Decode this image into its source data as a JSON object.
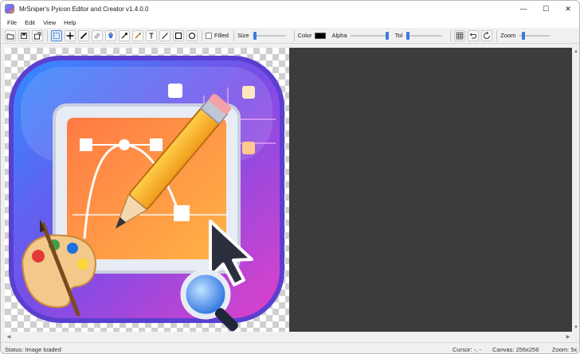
{
  "window": {
    "title": "MrSniper's Pyicon Editor and Creator v1.4.0.0",
    "controls": {
      "minimize": "—",
      "maximize": "☐",
      "close": "✕"
    }
  },
  "menu": {
    "items": [
      "File",
      "Edit",
      "View",
      "Help"
    ]
  },
  "toolbar": {
    "file_tools": [
      "open-icon",
      "save-icon",
      "export-icon"
    ],
    "draw_tools": [
      {
        "icon": "select-icon",
        "active": true
      },
      {
        "icon": "move-icon",
        "active": false
      },
      {
        "icon": "pencil-icon",
        "active": false
      },
      {
        "icon": "eraser-icon",
        "active": false
      },
      {
        "icon": "fill-bucket-icon",
        "active": false
      },
      {
        "icon": "eyedropper-icon",
        "active": false
      },
      {
        "icon": "brush-icon",
        "active": false
      },
      {
        "icon": "text-icon",
        "active": false
      },
      {
        "icon": "line-icon",
        "active": false
      },
      {
        "icon": "rectangle-icon",
        "active": false
      },
      {
        "icon": "ellipse-icon",
        "active": false
      }
    ],
    "filled_label": "Filled",
    "filled_checked": false,
    "size_label": "Size",
    "size_value": 0.03,
    "color_label": "Color",
    "color_value": "#000000",
    "alpha_label": "Alpha",
    "alpha_value": 1.0,
    "tol_label": "Tol",
    "tol_value": 0.03,
    "view_tools": [
      "grid-icon",
      "undo-icon",
      "redo-icon"
    ],
    "zoom_label": "Zoom",
    "zoom_value": 0.1
  },
  "status": {
    "message": "Status: Image loaded",
    "cursor": "Cursor: -, -",
    "canvas": "Canvas: 256x256",
    "zoom": "Zoom: 5x"
  },
  "colors": {
    "accent": "#3b7be0",
    "canvas_background": "#3c3c3c",
    "icon_gradient": [
      "#2f8cff",
      "#7a4de8",
      "#e040c8"
    ]
  }
}
